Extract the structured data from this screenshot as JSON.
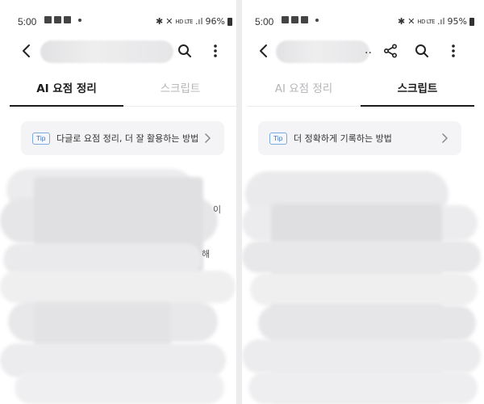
{
  "left_screen": {
    "status": {
      "time": "5:00",
      "battery": "96%",
      "network": "HD LTE"
    },
    "tabs": [
      {
        "label": "AI 요점 정리",
        "active": true
      },
      {
        "label": "스크립트",
        "active": false
      }
    ],
    "tip": {
      "badge": "Tip",
      "text": "다글로 요점 정리, 더 잘 활용하는 방법"
    },
    "visible_fragments": [
      "이",
      "해"
    ]
  },
  "right_screen": {
    "status": {
      "time": "5:00",
      "battery": "95%",
      "network": "HD LTE"
    },
    "title_ellipsis": "..",
    "tabs": [
      {
        "label": "AI 요점 정리",
        "active": false
      },
      {
        "label": "스크립트",
        "active": true
      }
    ],
    "tip": {
      "badge": "Tip",
      "text": "더 정확하게 기록하는 방법"
    }
  },
  "icons": {
    "back": "chevron-left-icon",
    "search": "search-icon",
    "more": "more-vertical-icon",
    "share": "share-icon",
    "tip_chevron": "chevron-right-icon"
  },
  "colors": {
    "active_tab": "#1c1c1e",
    "inactive_tab": "#b5b5b8",
    "tip_badge": "#3f78c6",
    "tip_background": "#f4f4f6"
  }
}
